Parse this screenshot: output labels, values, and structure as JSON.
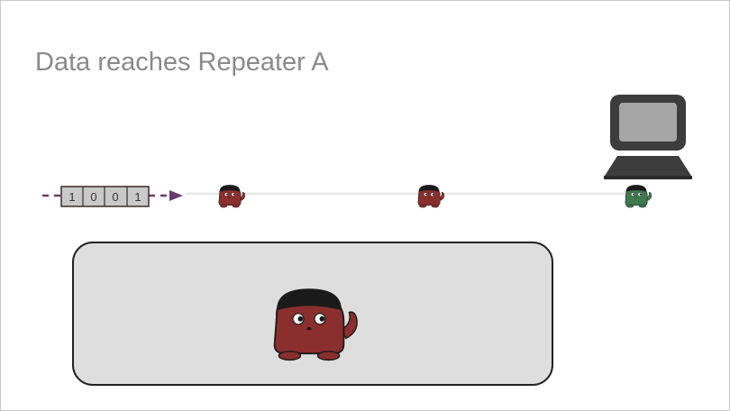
{
  "slide": {
    "title": "Data reaches Repeater A"
  },
  "packet": {
    "bits": [
      "1",
      "0",
      "0",
      "1"
    ]
  },
  "icons": {
    "repeater": "repeater-creature-icon",
    "destination": "destination-creature-icon",
    "computer": "computer-icon",
    "arrow": "arrowhead-icon"
  },
  "colors": {
    "repeater": "#8b2e2e",
    "destination": "#3f7a4f",
    "hat": "#1a1a1a",
    "arrow": "#6b3b6b",
    "wire": "#e6e6e6",
    "packet_fill": "#c9c9c9",
    "packet_border": "#3a2a2a",
    "panel_fill": "#dedede",
    "panel_border": "#222222",
    "title": "#8a8a8a"
  }
}
